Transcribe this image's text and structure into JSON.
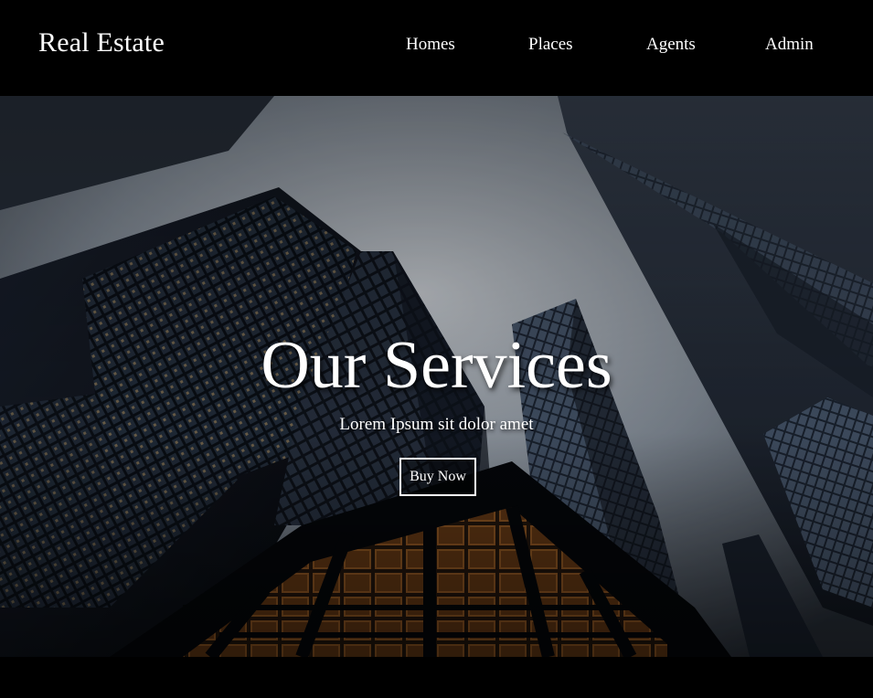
{
  "header": {
    "brand": "Real Estate",
    "nav": [
      {
        "label": "Homes"
      },
      {
        "label": "Places"
      },
      {
        "label": "Agents"
      },
      {
        "label": "Admin"
      }
    ]
  },
  "hero": {
    "title": "Our Services",
    "subtitle": "Lorem Ipsum sit dolor amet",
    "cta_label": "Buy Now",
    "background": "city-skyscrapers-photo"
  },
  "colors": {
    "header_bg": "#000000",
    "text": "#ffffff",
    "sky": "#c9d1da",
    "building_dark": "#141a22",
    "window_light": "#d89a4a"
  }
}
